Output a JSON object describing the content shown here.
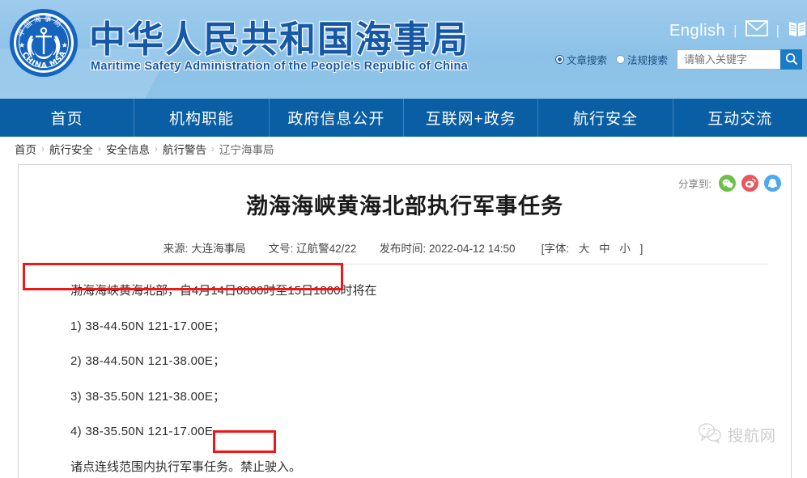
{
  "header": {
    "title_cn": "中华人民共和国海事局",
    "title_en": "Maritime Safety Administration of the People's Republic of China",
    "logo_name": "china-msa-emblem",
    "english_link": "English",
    "separator": "|",
    "mail_icon": "mail-icon",
    "book_icon": "book-icon",
    "search": {
      "radio_article": "文章搜索",
      "radio_regulation": "法规搜索",
      "placeholder": "请输入关键字",
      "value": "",
      "search_icon": "search-icon"
    }
  },
  "nav": {
    "items": [
      {
        "label": "首页"
      },
      {
        "label": "机构职能"
      },
      {
        "label": "政府信息公开"
      },
      {
        "label": "互联网+政务"
      },
      {
        "label": "航行安全"
      },
      {
        "label": "互动交流"
      }
    ]
  },
  "breadcrumb": {
    "separator": "›",
    "items": [
      {
        "label": "首页"
      },
      {
        "label": "航行安全"
      },
      {
        "label": "安全信息"
      },
      {
        "label": "航行警告"
      },
      {
        "label": "辽宁海事局"
      }
    ]
  },
  "article": {
    "share_label": "分享到:",
    "share_icons": [
      {
        "name": "wechat-share-icon",
        "color": "#6cc04a"
      },
      {
        "name": "weibo-share-icon",
        "color": "#e8575a"
      },
      {
        "name": "qq-share-icon",
        "color": "#4aa9f0"
      }
    ],
    "title": "渤海海峡黄海北部执行军事任务",
    "meta": {
      "source_label": "来源:",
      "source_value": "大连海事局",
      "docnum_label": "文号:",
      "docnum_value": "辽航警42/22",
      "time_label": "发布时间:",
      "time_value": "2022-04-12 14:50",
      "fontsize_prefix": "[字体:",
      "fontsize_large": "大",
      "fontsize_medium": "中",
      "fontsize_small": "小",
      "fontsize_suffix": "]"
    },
    "paragraphs": [
      {
        "text": "渤海海峡黄海北部，自4月14日0800时至15日1800时将在"
      },
      {
        "text": "1) 38-44.50N    121-17.00E；"
      },
      {
        "text": "2) 38-44.50N    121-38.00E；"
      },
      {
        "text": "3) 38-35.50N    121-38.00E；"
      },
      {
        "text": "4) 38-35.50N    121-17.00E"
      },
      {
        "text": "诸点连线范围内执行军事任务。禁止驶入。"
      }
    ]
  },
  "watermark": {
    "icon": "wechat-icon",
    "text": "搜航网"
  },
  "colors": {
    "nav_blue": "#0a5ea3",
    "header_blue": "#8fc4e9",
    "title_blue": "#1558a8",
    "annotation_red": "#f21616"
  }
}
